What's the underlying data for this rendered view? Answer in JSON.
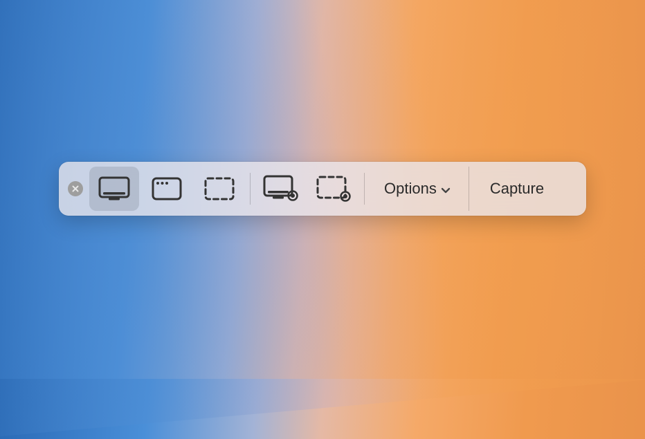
{
  "toolbar": {
    "options_label": "Options",
    "capture_label": "Capture",
    "selected_mode": "capture-entire-screen",
    "modes": [
      {
        "id": "capture-entire-screen"
      },
      {
        "id": "capture-selected-window"
      },
      {
        "id": "capture-selected-portion"
      },
      {
        "id": "record-entire-screen"
      },
      {
        "id": "record-selected-portion"
      }
    ]
  }
}
